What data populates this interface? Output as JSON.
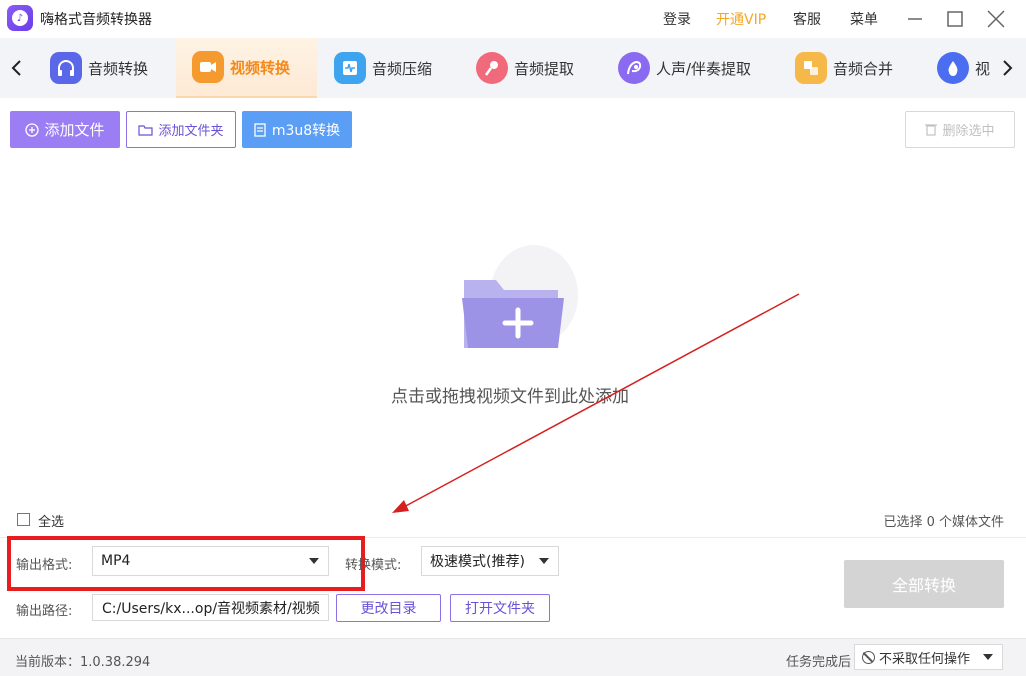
{
  "app": {
    "title": "嗨格式音频转换器"
  },
  "topbar": {
    "login": "登录",
    "vip": "开通VIP",
    "service": "客服",
    "menu": "菜单"
  },
  "tabs": [
    {
      "label": "音频转换",
      "icon": "headphones-icon",
      "color": "#5a67e8"
    },
    {
      "label": "视频转换",
      "icon": "video-camera-icon",
      "color": "#f59a2f",
      "active": true
    },
    {
      "label": "音频压缩",
      "icon": "waveform-icon",
      "color": "#3ea4ef"
    },
    {
      "label": "音频提取",
      "icon": "microphone-icon",
      "color": "#f06a7c"
    },
    {
      "label": "人声/伴奏提取",
      "icon": "vocal-icon",
      "color": "#8a6af0"
    },
    {
      "label": "音频合并",
      "icon": "merge-icon",
      "color": "#f7b84a"
    },
    {
      "label": "视",
      "icon": "drop-icon",
      "color": "#4b6ef0"
    }
  ],
  "toolbar": {
    "add_file": "添加文件",
    "add_folder": "添加文件夹",
    "m3u8": "m3u8转换",
    "delete_selected": "删除选中"
  },
  "drop": {
    "hint": "点击或拖拽视频文件到此处添加"
  },
  "selection": {
    "select_all": "全选",
    "count_text": "已选择 0 个媒体文件"
  },
  "settings": {
    "format_label": "输出格式:",
    "format_value": "MP4",
    "mode_label": "转换模式:",
    "mode_value": "极速模式(推荐)",
    "path_label": "输出路径:",
    "path_value": "C:/Users/kx...op/音视频素材/视频",
    "change_dir": "更改目录",
    "open_folder": "打开文件夹",
    "convert_all": "全部转换"
  },
  "status": {
    "version": "当前版本：1.0.38.294",
    "after_label": "任务完成后",
    "after_value": "不采取任何操作"
  },
  "colors": {
    "accent": "#9b7ef3",
    "highlight": "#e81e1e",
    "active_tab": "#f38a19"
  }
}
